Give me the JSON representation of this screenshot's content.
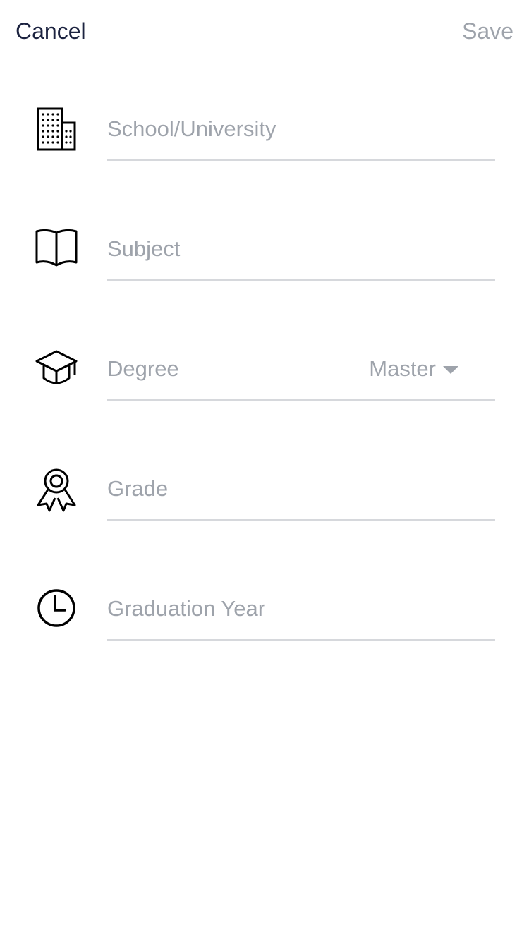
{
  "header": {
    "cancel_label": "Cancel",
    "save_label": "Save"
  },
  "form": {
    "school": {
      "icon": "building-icon",
      "placeholder": "School/University",
      "value": ""
    },
    "subject": {
      "icon": "open-book-icon",
      "placeholder": "Subject",
      "value": ""
    },
    "degree": {
      "icon": "graduation-cap-icon",
      "label": "Degree",
      "selected": "Master"
    },
    "grade": {
      "icon": "award-ribbon-icon",
      "placeholder": "Grade",
      "value": ""
    },
    "graduation_year": {
      "icon": "clock-icon",
      "placeholder": "Graduation Year",
      "value": ""
    }
  },
  "colors": {
    "primary_text": "#1c2340",
    "muted_text": "#9ea3ab",
    "divider": "#d6d8dc",
    "icon_stroke": "#000000"
  }
}
